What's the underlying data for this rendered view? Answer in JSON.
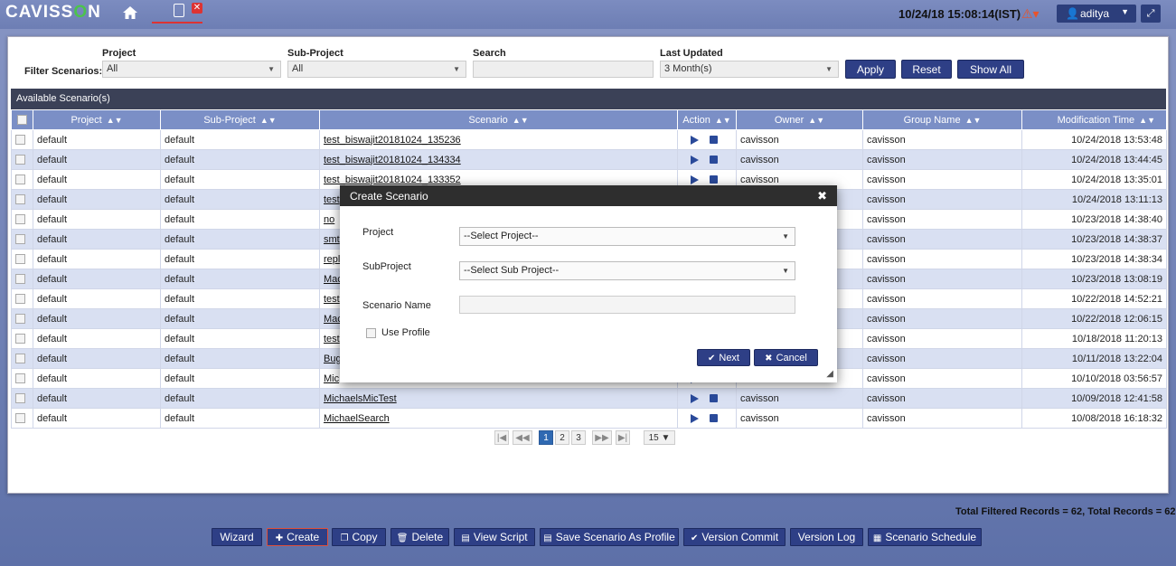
{
  "header": {
    "logo_pre": "CAVISS",
    "logo_o": "O",
    "logo_post": "N",
    "datetime": "10/24/18 15:08:14(IST)",
    "user": "aditya"
  },
  "filters": {
    "title": "Filter Scenarios:",
    "project_label": "Project",
    "project_value": "All",
    "subproject_label": "Sub-Project",
    "subproject_value": "All",
    "search_label": "Search",
    "search_value": "",
    "updated_label": "Last Updated",
    "updated_value": "3 Month(s)",
    "apply": "Apply",
    "reset": "Reset",
    "show_all": "Show All"
  },
  "grid": {
    "title": "Available Scenario(s)",
    "columns": [
      "Project",
      "Sub-Project",
      "Scenario",
      "Action",
      "Owner",
      "Group Name",
      "Modification Time"
    ],
    "rows": [
      [
        "default",
        "default",
        "test_biswajit20181024_135236",
        "cavisson",
        "cavisson",
        "10/24/2018 13:53:48"
      ],
      [
        "default",
        "default",
        "test_biswajit20181024_134334",
        "cavisson",
        "cavisson",
        "10/24/2018 13:44:45"
      ],
      [
        "default",
        "default",
        "test_biswajit20181024_133352",
        "cavisson",
        "cavisson",
        "10/24/2018 13:35:01"
      ],
      [
        "default",
        "default",
        "test",
        "",
        "cavisson",
        "10/24/2018 13:11:13"
      ],
      [
        "default",
        "default",
        "no",
        "",
        "cavisson",
        "10/23/2018 14:38:40"
      ],
      [
        "default",
        "default",
        "smt",
        "",
        "cavisson",
        "10/23/2018 14:38:37"
      ],
      [
        "default",
        "default",
        "repl",
        "",
        "cavisson",
        "10/23/2018 14:38:34"
      ],
      [
        "default",
        "default",
        "Mac",
        "",
        "cavisson",
        "10/23/2018 13:08:19"
      ],
      [
        "default",
        "default",
        "test",
        "",
        "cavisson",
        "10/22/2018 14:52:21"
      ],
      [
        "default",
        "default",
        "Mac",
        "",
        "cavisson",
        "10/22/2018 12:06:15"
      ],
      [
        "default",
        "default",
        "test",
        "",
        "cavisson",
        "10/18/2018 11:20:13"
      ],
      [
        "default",
        "default",
        "Bug",
        "",
        "cavisson",
        "10/11/2018 13:22:04"
      ],
      [
        "default",
        "default",
        "Mic",
        "",
        "cavisson",
        "10/10/2018 03:56:57"
      ],
      [
        "default",
        "default",
        "MichaelsMicTest",
        "cavisson",
        "cavisson",
        "10/09/2018 12:41:58"
      ],
      [
        "default",
        "default",
        "MichaelSearch",
        "cavisson",
        "cavisson",
        "10/08/2018 16:18:32"
      ]
    ]
  },
  "pager": {
    "pages": [
      "1",
      "2",
      "3"
    ],
    "page_size": "15 ▼"
  },
  "totals": "Total Filtered Records = 62, Total Records = 62",
  "toolbar": {
    "wizard": "Wizard",
    "create": "Create",
    "copy": "Copy",
    "delete": "Delete",
    "view_script": "View Script",
    "save_profile": "Save Scenario As Profile",
    "version_commit": "Version Commit",
    "version_log": "Version Log",
    "schedule": "Scenario Schedule"
  },
  "modal": {
    "title": "Create Scenario",
    "project_label": "Project",
    "project_value": "--Select Project--",
    "subproject_label": "SubProject",
    "subproject_value": "--Select Sub Project--",
    "name_label": "Scenario Name",
    "name_value": "",
    "use_profile": "Use Profile",
    "next": "Next",
    "cancel": "Cancel"
  }
}
